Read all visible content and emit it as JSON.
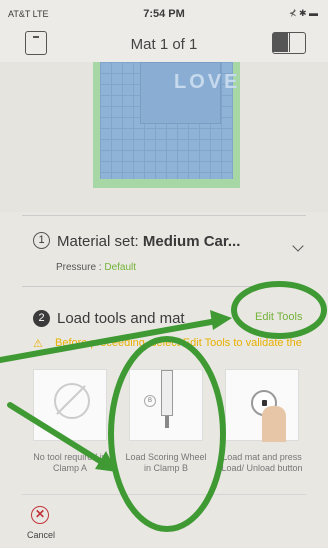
{
  "status_bar": {
    "carrier": "AT&T  LTE",
    "time": "7:54 PM",
    "right": "⊀ ✱ ▬"
  },
  "nav": {
    "title": "Mat 1 of 1",
    "mat_icon": "mat-icon",
    "layout_icon": "split-view-icon"
  },
  "preview": {
    "design_text": "LOVE"
  },
  "step1": {
    "number": "1",
    "label": "Material set: ",
    "value": "Medium Car...",
    "pressure_label": "Pressure : ",
    "pressure_value": "Default"
  },
  "step2": {
    "number": "2",
    "label": "Load tools and mat",
    "edit_tools": "Edit Tools",
    "warning": "Before proceeding, select Edit Tools to validate the"
  },
  "tools": [
    {
      "caption": "No tool required in Clamp A",
      "icon": "no-tool-icon"
    },
    {
      "caption": "Load Scoring Wheel in Clamp B",
      "icon": "scoring-wheel-icon"
    },
    {
      "caption": "Load mat and press Load/ Unload button",
      "icon": "load-button-icon"
    }
  ],
  "cancel": {
    "label": "Cancel",
    "icon": "close-icon"
  },
  "colors": {
    "accent_green": "#74b33a",
    "warning_yellow": "#e8b000",
    "annotation_green": "#3f9a34",
    "cancel_red": "#c0353a"
  }
}
